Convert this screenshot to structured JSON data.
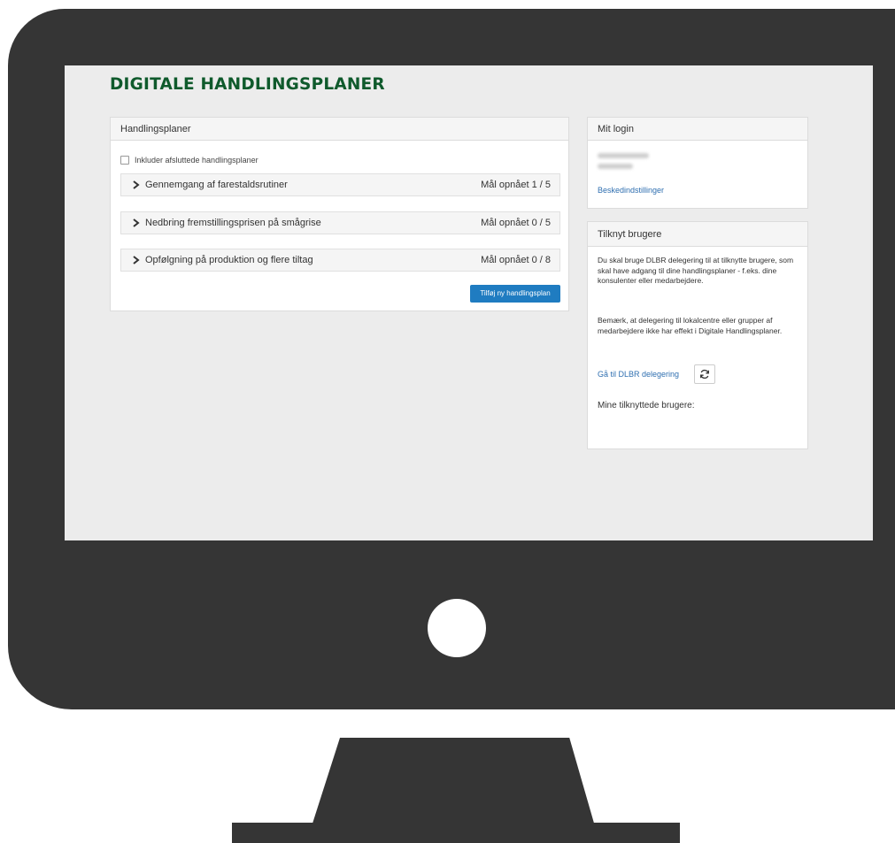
{
  "brand": {
    "title": "DIGITALE HANDLINGSPLANER",
    "color": "#0f5a2c"
  },
  "plans_panel": {
    "heading": "Handlingsplaner",
    "include_finished_label": "Inkluder afsluttede handlingsplaner",
    "include_finished_checked": false,
    "items": [
      {
        "title": "Gennemgang af farestaldsrutiner",
        "progress": "Mål opnået 1 / 5"
      },
      {
        "title": "Nedbring fremstillingsprisen på smågrise",
        "progress": "Mål opnået 0 / 5"
      },
      {
        "title": "Opfølgning på produktion og flere tiltag",
        "progress": "Mål opnået 0 / 8"
      }
    ],
    "add_button_label": "Tilføj ny handlingsplan",
    "add_button_color": "#1f7cc1"
  },
  "login_panel": {
    "heading": "Mit login",
    "message_settings_link": "Beskedindstillinger"
  },
  "link_users_panel": {
    "heading": "Tilknyt brugere",
    "description_1": "Du skal bruge DLBR delegering til at tilknytte brugere, som skal have adgang til dine handlingsplaner - f.eks. dine konsulenter eller medarbejdere.",
    "description_2": "Bemærk, at delegering til lokalcentre eller grupper af medarbejdere ikke har effekt i Digitale Handlingsplaner.",
    "delegation_link": "Gå til DLBR delegering",
    "my_users_label": "Mine tilknyttede brugere:"
  },
  "icons": {
    "chevron": "chevron-right-icon",
    "refresh": "refresh-icon"
  }
}
